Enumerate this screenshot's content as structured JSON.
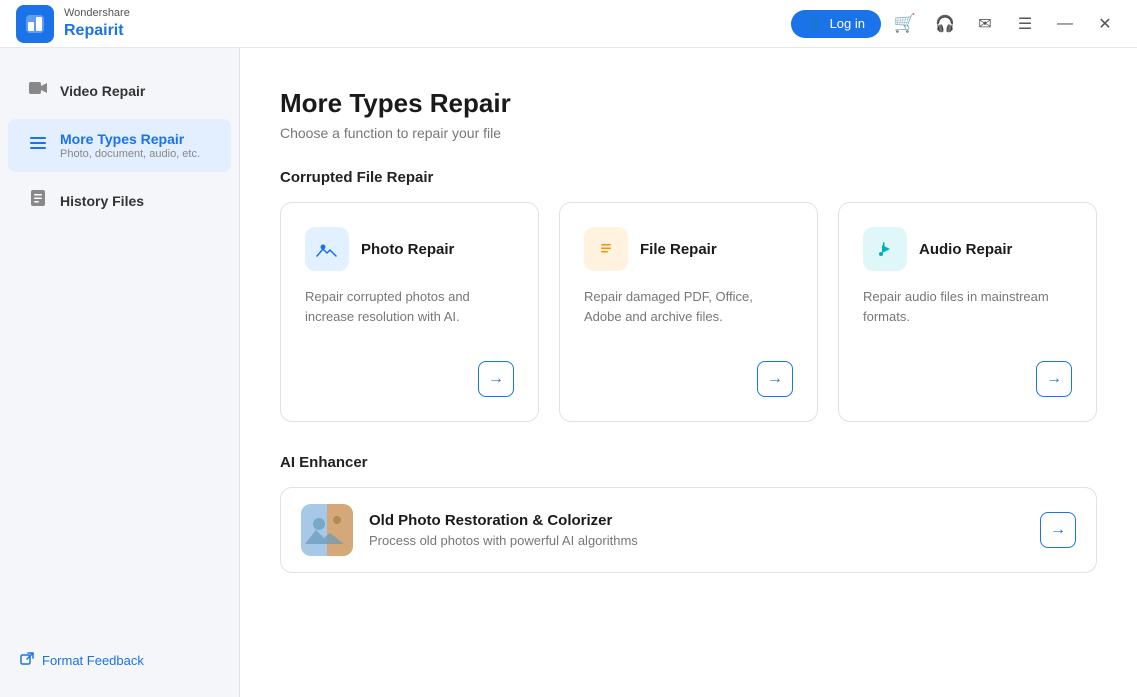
{
  "titlebar": {
    "logo_brand": "Wondershare",
    "logo_product": "Repairit",
    "login_label": "Log in",
    "cart_icon": "🛒",
    "headset_icon": "🎧",
    "mail_icon": "✉",
    "list_icon": "☰",
    "minimize_icon": "—",
    "close_icon": "✕"
  },
  "sidebar": {
    "items": [
      {
        "label": "Video Repair",
        "sub": "",
        "icon": "🎬",
        "active": false
      },
      {
        "label": "More Types Repair",
        "sub": "Photo, document, audio, etc.",
        "icon": "☰",
        "active": true
      },
      {
        "label": "History Files",
        "sub": "",
        "icon": "🗂",
        "active": false
      }
    ],
    "feedback_label": "Format Feedback",
    "feedback_icon": "↗"
  },
  "main": {
    "page_title": "More Types Repair",
    "page_subtitle": "Choose a function to repair your file",
    "corrupted_section_title": "Corrupted File Repair",
    "cards": [
      {
        "title": "Photo Repair",
        "desc": "Repair corrupted photos and increase resolution with AI.",
        "icon": "🖼",
        "icon_class": "icon-photo"
      },
      {
        "title": "File Repair",
        "desc": "Repair damaged PDF, Office, Adobe and archive files.",
        "icon": "📄",
        "icon_class": "icon-file"
      },
      {
        "title": "Audio Repair",
        "desc": "Repair audio files in mainstream formats.",
        "icon": "🎵",
        "icon_class": "icon-audio"
      }
    ],
    "ai_section_title": "AI Enhancer",
    "enhancer": {
      "title": "Old Photo Restoration & Colorizer",
      "desc": "Process old photos with powerful AI algorithms",
      "icon": "🖼"
    }
  }
}
